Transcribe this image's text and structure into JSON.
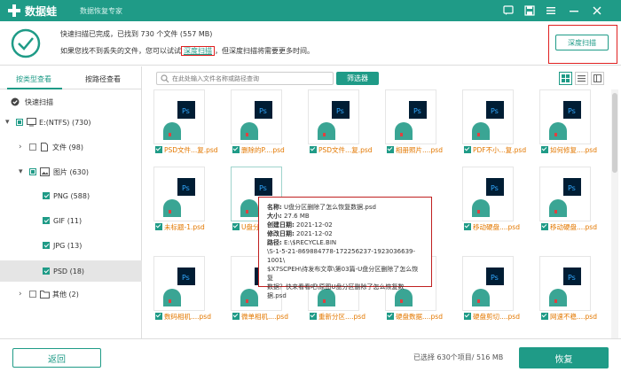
{
  "titlebar": {
    "app_name": "数据蛙",
    "slogan": "数据恢复专家"
  },
  "info": {
    "line1": "快速扫描已完成，已找到 730 个文件 (557 MB)",
    "line2_prefix": "如果您找不到丢失的文件，您可以试试",
    "line2_link": "深度扫描",
    "line2_suffix": "，但深度扫描将需要更多时间。",
    "deep_button": "深度扫描"
  },
  "sidebar": {
    "tabs": [
      "按类型查看",
      "按路径查看"
    ],
    "quick_scan": "快速扫描",
    "tree": {
      "drive": "E:(NTFS) (730)",
      "file": "文件 (98)",
      "image": "图片 (630)",
      "png": "PNG (588)",
      "gif": "GIF (11)",
      "jpg": "JPG (13)",
      "psd": "PSD (18)",
      "other": "其他 (2)"
    }
  },
  "toolbar": {
    "search_placeholder": "在此处输入文件名称或路径查询",
    "filter": "筛选器"
  },
  "files": {
    "row1": [
      "PSD文件...复.psd",
      "删除的P....psd",
      "PSD文件...复.psd",
      "相册照片....psd",
      "PDF不小...复.psd",
      "如何修复....psd"
    ],
    "row2": [
      "未标题-1.psd",
      "U盘分...复.psd",
      "",
      "",
      "移动硬盘....psd",
      "移动硬盘....psd"
    ],
    "row3": [
      "数码相机....psd",
      "微单相机....psd",
      "重新分区....psd",
      "硬盘数据....psd",
      "硬盘剪切....psd",
      "网速不稳....psd"
    ],
    "ps_label": "Ps"
  },
  "tooltip": {
    "name_label": "名称:",
    "name": "U盘分区删除了怎么恢复数据.psd",
    "size_label": "大小:",
    "size": "27.6 MB",
    "created_label": "创建日期:",
    "created": "2021-12-02",
    "modified_label": "修改日期:",
    "modified": "2021-12-02",
    "path_label": "路径:",
    "path_lines": [
      "E:\\$RECYCLE.BIN",
      "\\S-1-5-21-869884778-172256237-1923036639-1001\\",
      "$X7SCPEH\\待发布文章\\第03篇-U盘分区删除了怎么恢复",
      "数据？快来看看吧\\原图U盘分区删除了怎么恢复数",
      "据.psd"
    ]
  },
  "footer": {
    "back": "返回",
    "selected": "已选择 630个项目/ 516 MB",
    "recover": "恢复"
  },
  "colors": {
    "accent": "#1f9b87",
    "file_name": "#e37800",
    "highlight_border": "#e02020"
  }
}
